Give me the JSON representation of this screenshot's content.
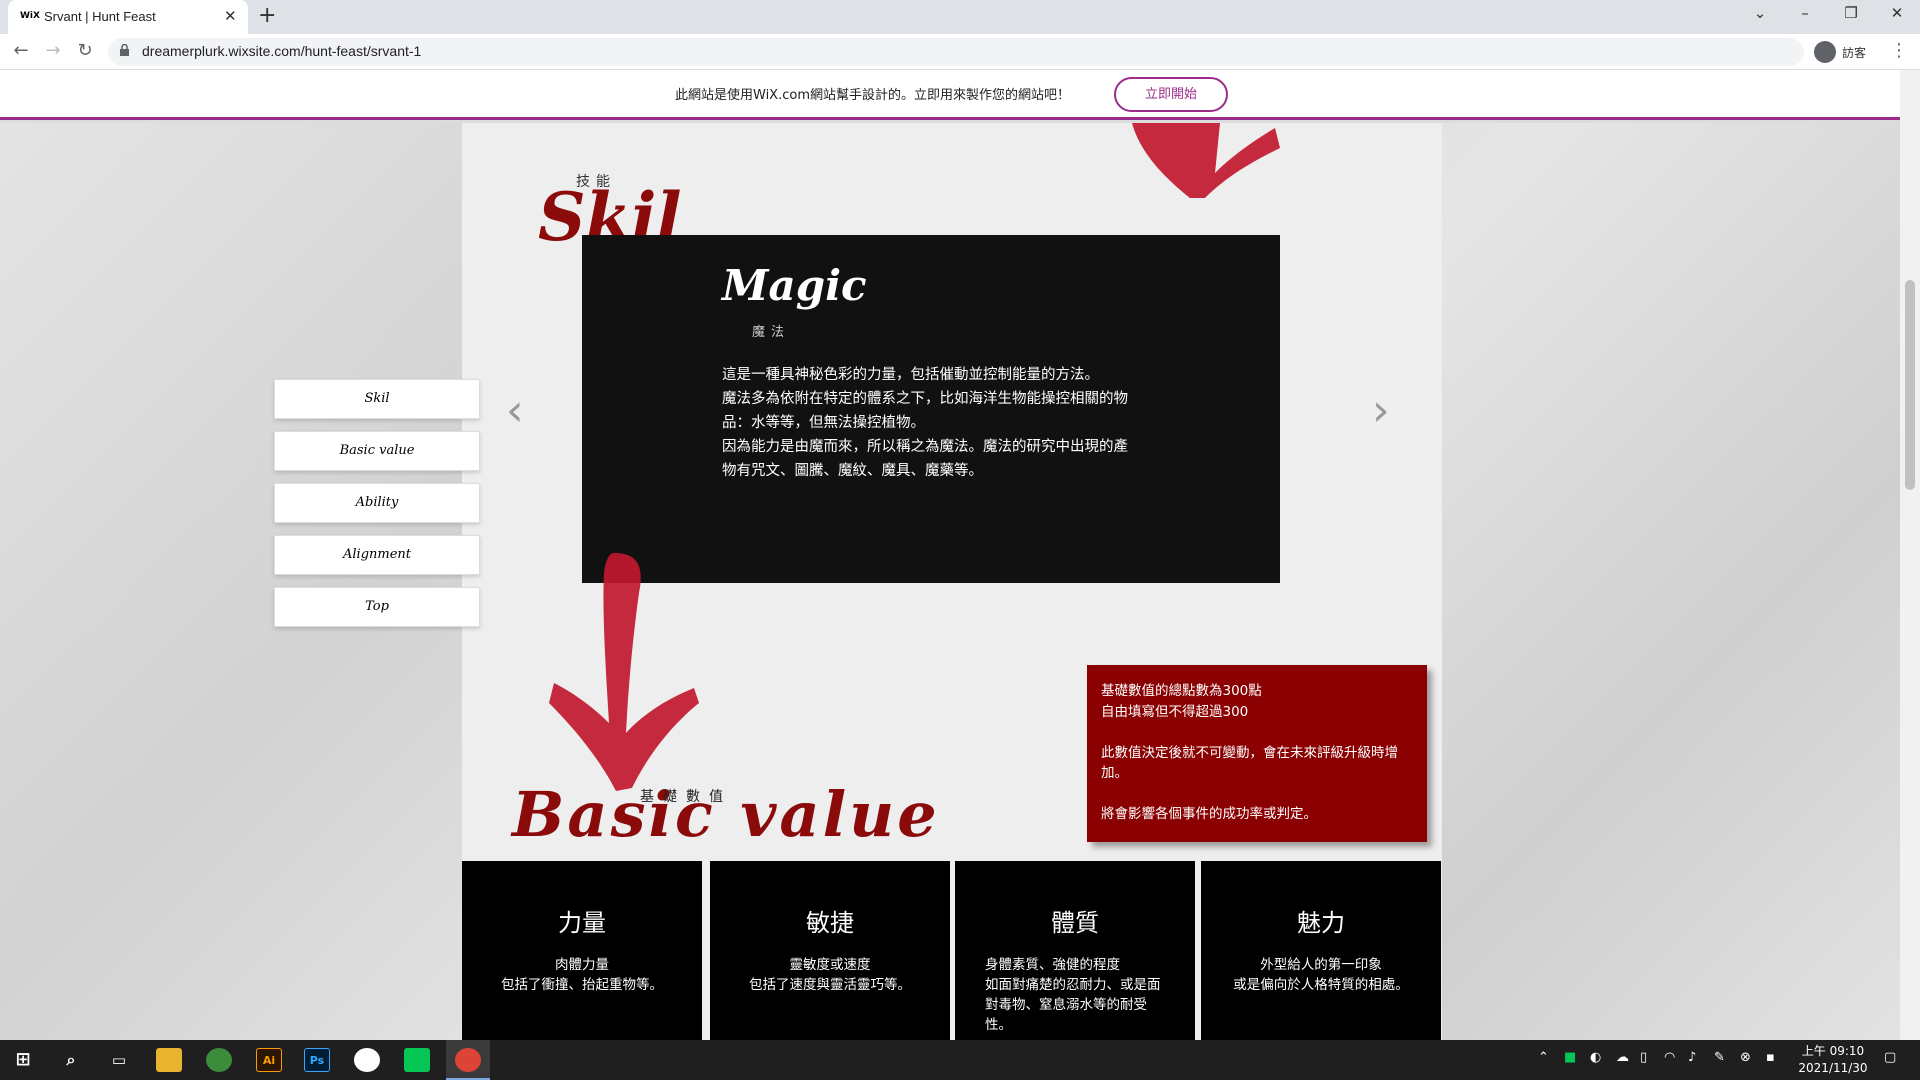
{
  "browser": {
    "tab_favicon": "WiX",
    "tab_title": "Srvant | Hunt Feast",
    "url": "dreamerplurk.wixsite.com/hunt-feast/srvant-1",
    "profile_label": "訪客"
  },
  "wix_banner": {
    "text": "此網站是使用WiX.com網站幫手設計的。立即用來製作您的網站吧！",
    "cta": "立即開始",
    "accent_color": "#9b2c8a"
  },
  "sidenav": {
    "items": [
      {
        "label": "Skil"
      },
      {
        "label": "Basic value"
      },
      {
        "label": "Ability"
      },
      {
        "label": "Alignment"
      },
      {
        "label": "Top"
      }
    ]
  },
  "skil": {
    "subtitle": "技能",
    "title": "Skil",
    "card": {
      "title": "Magic",
      "subtitle": "魔法",
      "description": "這是一種具神秘色彩的力量，包括催動並控制能量的方法。\n魔法多為依附在特定的體系之下，比如海洋生物能操控相關的物品：水等等，但無法操控植物。\n因為能力是由魔而來，所以稱之為魔法。魔法的研究中出現的產物有咒文、圖騰、魔紋、魔具、魔藥等。"
    },
    "prev_icon": "chevron-left-icon",
    "next_icon": "chevron-right-icon"
  },
  "info_box": {
    "text": "基礎數值的總點數為300點\n自由填寫但不得超過300\n\n此數值決定後就不可變動，會在未來評級升級時增加。\n\n將會影響各個事件的成功率或判定。",
    "color": "#8b0000"
  },
  "basic_value": {
    "subtitle": "基礎數值",
    "title": "Basic value",
    "stats": [
      {
        "name": "力量",
        "desc": "肉體力量\n包括了衝撞、抬起重物等。"
      },
      {
        "name": "敏捷",
        "desc": "靈敏度或速度\n包括了速度與靈活靈巧等。"
      },
      {
        "name": "體質",
        "desc": "身體素質、強健的程度\n如面對痛楚的忍耐力、或是面對毒物、窒息溺水等的耐受性。"
      },
      {
        "name": "魅力",
        "desc": "外型給人的第一印象\n或是偏向於人格特質的相處。"
      }
    ]
  },
  "taskbar": {
    "apps": [
      "start-icon",
      "search-icon",
      "task-view-icon",
      "file-explorer-icon",
      "chrome-profile-icon",
      "illustrator-icon",
      "photoshop-icon",
      "plurk-icon",
      "line-icon",
      "chrome-icon"
    ],
    "illustrator_label": "Ai",
    "photoshop_label": "Ps",
    "clock": "上午 09:10\n2021/11/30"
  },
  "colors": {
    "title_red": "#8b0a0a",
    "arrow_red": "#c0182e"
  }
}
